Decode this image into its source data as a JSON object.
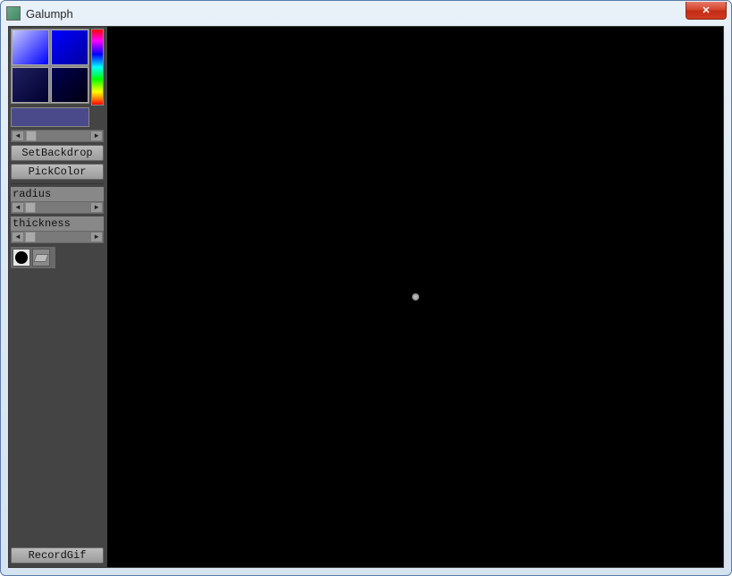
{
  "window": {
    "title": "Galumph"
  },
  "sidebar": {
    "set_backdrop_label": "SetBackdrop",
    "pick_color_label": "PickColor",
    "radius_label": "radius",
    "thickness_label": "thickness",
    "record_gif_label": "RecordGif",
    "selected_color": "#4a4a8a"
  },
  "tools": {
    "brush_name": "brush",
    "eraser_name": "eraser"
  }
}
